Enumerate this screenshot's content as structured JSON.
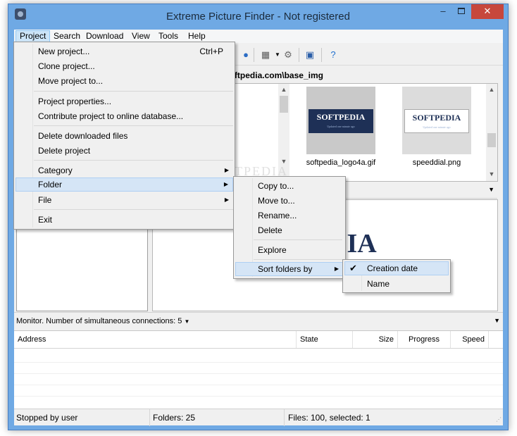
{
  "window": {
    "title": "Extreme Picture Finder - Not registered",
    "minimize_glyph": "‒",
    "close_glyph": "✕"
  },
  "menubar": {
    "items": [
      {
        "label": "Project"
      },
      {
        "label": "Search"
      },
      {
        "label": "Download"
      },
      {
        "label": "View"
      },
      {
        "label": "Tools"
      },
      {
        "label": "Help"
      }
    ]
  },
  "toolbar": {
    "icons": [
      "grid-view-icon",
      "dropdown-arrow-icon",
      "settings-icon",
      "picture-icon",
      "help-icon"
    ]
  },
  "path_bar": {
    "text": "eb Pictures\\www.softpedia.com\\base_img"
  },
  "thumbnails": [
    {
      "file": "softpedia_logo4a.gif",
      "logo_text": "SOFTPEDIA",
      "tagline": "Updated one minute ago",
      "selected": false
    },
    {
      "file": "speeddial.png",
      "logo_text": "SOFTPEDIA",
      "tagline": "Updated one minute ago",
      "selected": true
    }
  ],
  "preview": {
    "logo_text": "DIA"
  },
  "watermark": "SOFTPEDIA",
  "project_menu": {
    "items": [
      {
        "label": "New project...",
        "shortcut": "Ctrl+P"
      },
      {
        "label": "Clone project..."
      },
      {
        "label": "Move project to..."
      },
      {
        "label": "Project properties..."
      },
      {
        "label": "Contribute project to online database..."
      },
      {
        "label": "Delete downloaded files"
      },
      {
        "label": "Delete project"
      },
      {
        "label": "Category"
      },
      {
        "label": "Folder"
      },
      {
        "label": "File"
      },
      {
        "label": "Exit"
      }
    ]
  },
  "folder_menu": {
    "items": [
      {
        "label": "Copy to..."
      },
      {
        "label": "Move to..."
      },
      {
        "label": "Rename..."
      },
      {
        "label": "Delete"
      },
      {
        "label": "Explore"
      },
      {
        "label": "Sort folders by"
      }
    ]
  },
  "sort_menu": {
    "items": [
      {
        "label": "Creation date",
        "checked": true
      },
      {
        "label": "Name",
        "checked": false
      }
    ]
  },
  "monitor": {
    "label": "Monitor. Number of simultaneous connections: 5",
    "columns": [
      "Address",
      "State",
      "Size",
      "Progress",
      "Speed"
    ]
  },
  "statusbar": {
    "status": "Stopped by user",
    "folders": "Folders: 25",
    "files": "Files: 100, selected: 1"
  }
}
